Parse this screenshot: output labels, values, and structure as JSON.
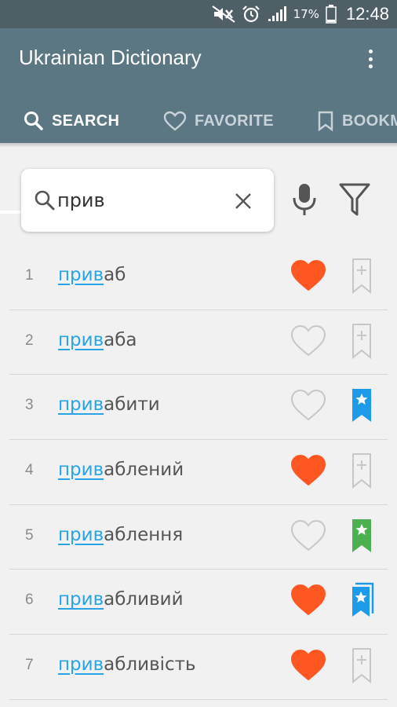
{
  "status_bar": {
    "battery_percent": "17%",
    "time": "12:48"
  },
  "app": {
    "title": "Ukrainian Dictionary"
  },
  "tabs": [
    {
      "label": "SEARCH",
      "icon": "search-icon",
      "active": true
    },
    {
      "label": "FAVORITE",
      "icon": "heart-outline-icon",
      "active": false
    },
    {
      "label": "BOOKM",
      "icon": "bookmark-outline-icon",
      "active": false
    }
  ],
  "search": {
    "value": "прив"
  },
  "colors": {
    "appbar": "#5c7784",
    "statusbar": "#4e5f66",
    "highlight": "#29a5e6",
    "heart_filled": "#ff5722",
    "bookmark_blue": "#1e9be8",
    "bookmark_green": "#4caf50",
    "outline_gray": "#c7c7c7"
  },
  "results": [
    {
      "num": "1",
      "prefix": "прив",
      "rest": "аб",
      "favorite": true,
      "bookmark": "add"
    },
    {
      "num": "2",
      "prefix": "прив",
      "rest": "аба",
      "favorite": false,
      "bookmark": "add"
    },
    {
      "num": "3",
      "prefix": "прив",
      "rest": "абити",
      "favorite": false,
      "bookmark": "blue"
    },
    {
      "num": "4",
      "prefix": "прив",
      "rest": "аблений",
      "favorite": true,
      "bookmark": "add"
    },
    {
      "num": "5",
      "prefix": "прив",
      "rest": "аблення",
      "favorite": false,
      "bookmark": "green"
    },
    {
      "num": "6",
      "prefix": "прив",
      "rest": "абливий",
      "favorite": true,
      "bookmark": "blue-multi"
    },
    {
      "num": "7",
      "prefix": "прив",
      "rest": "абливість",
      "favorite": true,
      "bookmark": "add"
    }
  ]
}
